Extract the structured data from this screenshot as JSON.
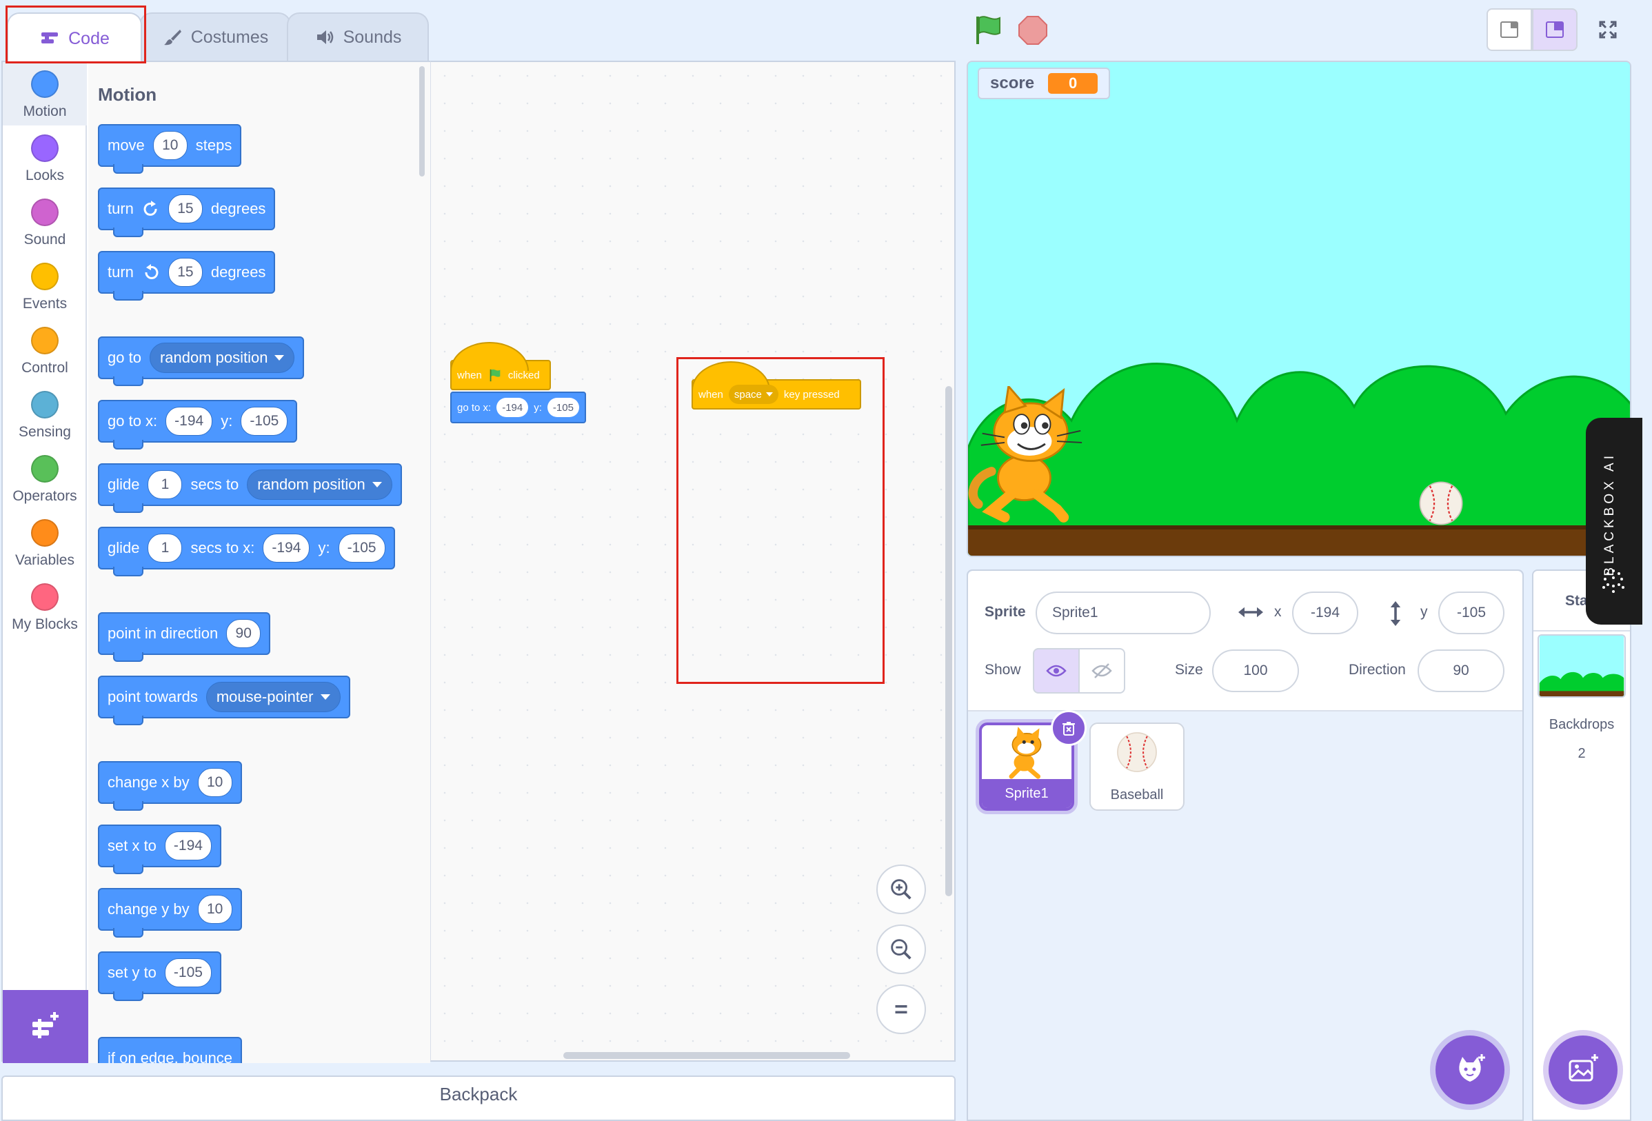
{
  "tabs": [
    {
      "label": "Code",
      "icon": "code-icon"
    },
    {
      "label": "Costumes",
      "icon": "brush-icon"
    },
    {
      "label": "Sounds",
      "icon": "speaker-icon"
    }
  ],
  "categories": [
    {
      "label": "Motion",
      "color": "#4c97ff"
    },
    {
      "label": "Looks",
      "color": "#9966ff"
    },
    {
      "label": "Sound",
      "color": "#cf63cf"
    },
    {
      "label": "Events",
      "color": "#ffbf00"
    },
    {
      "label": "Control",
      "color": "#ffab19"
    },
    {
      "label": "Sensing",
      "color": "#5cb1d6"
    },
    {
      "label": "Operators",
      "color": "#59c059"
    },
    {
      "label": "Variables",
      "color": "#ff8c1a"
    },
    {
      "label": "My Blocks",
      "color": "#ff6680"
    }
  ],
  "palette": {
    "heading": "Motion",
    "move": {
      "t1": "move",
      "v": "10",
      "t2": "steps"
    },
    "turn_right": {
      "t1": "turn",
      "v": "15",
      "t2": "degrees"
    },
    "turn_left": {
      "t1": "turn",
      "v": "15",
      "t2": "degrees"
    },
    "goto": {
      "t1": "go to",
      "menu": "random position"
    },
    "goto_xy": {
      "t1": "go to x:",
      "x": "-194",
      "t2": "y:",
      "y": "-105"
    },
    "glide_to": {
      "t1": "glide",
      "v": "1",
      "t2": "secs to",
      "menu": "random position"
    },
    "glide_xy": {
      "t1": "glide",
      "v": "1",
      "t2": "secs to x:",
      "x": "-194",
      "t3": "y:",
      "y": "-105"
    },
    "point_dir": {
      "t1": "point in direction",
      "v": "90"
    },
    "point_towards": {
      "t1": "point towards",
      "menu": "mouse-pointer"
    },
    "change_x": {
      "t1": "change x by",
      "v": "10"
    },
    "set_x": {
      "t1": "set x to",
      "v": "-194"
    },
    "change_y": {
      "t1": "change y by",
      "v": "10"
    },
    "set_y": {
      "t1": "set y to",
      "v": "-105"
    },
    "edge_bounce": {
      "t1": "if on edge, bounce"
    }
  },
  "workspace": {
    "script1": {
      "hat_t1": "when",
      "hat_t2": "clicked",
      "goto_t1": "go to x:",
      "x": "-194",
      "goto_t2": "y:",
      "y": "-105"
    },
    "script2": {
      "t1": "when",
      "key": "space",
      "t2": "key pressed"
    }
  },
  "backpack": "Backpack",
  "stage": {
    "monitor_label": "score",
    "monitor_value": "0"
  },
  "sprite_info": {
    "sprite_label": "Sprite",
    "sprite_name": "Sprite1",
    "x_label": "x",
    "x": "-194",
    "y_label": "y",
    "y": "-105",
    "show_label": "Show",
    "size_label": "Size",
    "size": "100",
    "direction_label": "Direction",
    "direction": "90"
  },
  "sprites": [
    "Sprite1",
    "Baseball"
  ],
  "stage_selector": {
    "title": "Stage",
    "backdrops_label": "Backdrops",
    "backdrops_count": "2"
  },
  "blackbox": "BLACKBOX AI",
  "colors": {
    "accent": "#855cd6",
    "motion": "#4c97ff",
    "events": "#ffbf00",
    "highlight": "#e0241c"
  }
}
